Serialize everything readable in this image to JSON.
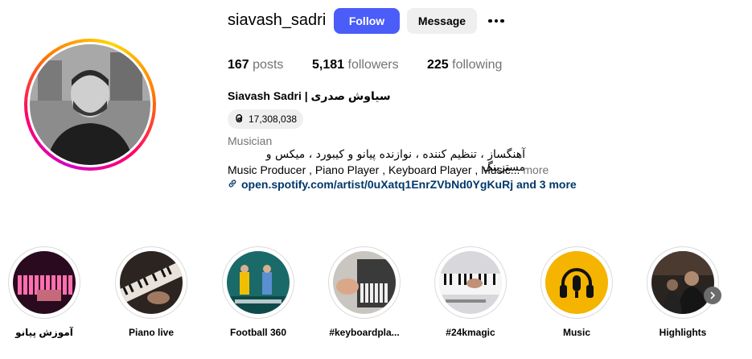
{
  "profile": {
    "username": "siavash_sadri",
    "follow_label": "Follow",
    "message_label": "Message",
    "more_icon": "ellipsis-icon",
    "stats": {
      "posts_count": "167",
      "posts_label": "posts",
      "followers_count": "5,181",
      "followers_label": "followers",
      "following_count": "225",
      "following_label": "following"
    },
    "full_name": "Siavash Sadri | سیاوش صدری",
    "threads_icon": "threads-icon",
    "threads_count": "17,308,038",
    "category": "Musician",
    "bio_persian": "آهنگساز ، تنظیم کننده ، نوازنده پیانو و کیبورد ، میکس و مسترینگ",
    "bio_english": "Music Producer , Piano Player , Keyboard Player , Music...",
    "bio_more": "more",
    "link_icon": "link-icon",
    "link_text": "open.spotify.com/artist/0uXatq1EnrZVbNd0YgKuRj and 3 more"
  },
  "highlights": [
    {
      "label": "آموزش پیانو"
    },
    {
      "label": "Piano live"
    },
    {
      "label": "Football 360"
    },
    {
      "label": "#keyboardpla..."
    },
    {
      "label": "#24kmagic"
    },
    {
      "label": "Music"
    },
    {
      "label": "Highlights"
    }
  ],
  "colors": {
    "follow_button": "#4a5df9",
    "link": "#00376b",
    "music_highlight": "#f5b400"
  }
}
